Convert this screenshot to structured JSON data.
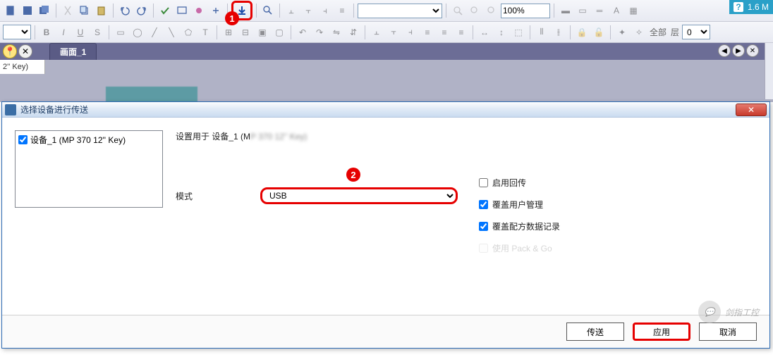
{
  "corner": {
    "help": "?",
    "ver": "1.6 M"
  },
  "toolbar": {
    "zoom_value": "100%",
    "layer_label": "全部",
    "layer2_label": "层",
    "layer_num": "0"
  },
  "tab": {
    "title": "画面_1"
  },
  "left_panel": {
    "text": "2'' Key)"
  },
  "dialog": {
    "title": "选择设备进行传送",
    "device_label": "设备_1 (MP 370 12'' Key)",
    "settings_prefix": "设置用于 设备_1 (M",
    "mode_label": "模式",
    "mode_value": "USB",
    "chk_back": "启用回传",
    "chk_user": "覆盖用户管理",
    "chk_recipe": "覆盖配方数据记录",
    "chk_pack": "使用 Pack & Go",
    "btn_transfer": "传送",
    "btn_apply": "应用",
    "btn_cancel": "取消"
  },
  "callouts": {
    "c1": "1",
    "c2": "2"
  },
  "watermark": {
    "text": "剑指工控"
  }
}
